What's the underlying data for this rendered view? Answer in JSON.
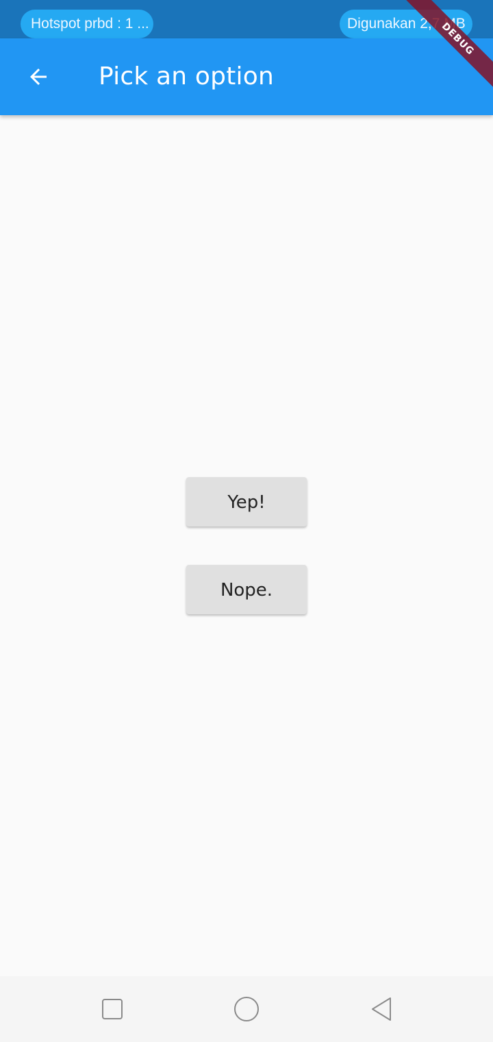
{
  "status_bar": {
    "hotspot_label": "Hotspot prbd : 1 ...",
    "data_usage_label": "Digunakan 2,7 MB"
  },
  "app_bar": {
    "title": "Pick an option",
    "back_icon": "arrow-back-icon"
  },
  "debug_banner": {
    "label": "DEBUG"
  },
  "options": {
    "yes_label": "Yep!",
    "no_label": "Nope."
  },
  "nav_bar": {
    "recents_icon": "square-recents-icon",
    "home_icon": "circle-home-icon",
    "back_icon": "triangle-back-icon"
  },
  "colors": {
    "status_bar": "#1a74ba",
    "status_pill": "#25a9f2",
    "app_bar": "#2196f3",
    "background": "#fafafa",
    "button": "#e0e0e0",
    "debug_banner": "#82142a"
  }
}
